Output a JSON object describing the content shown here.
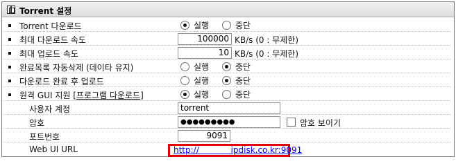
{
  "header": {
    "title": "Torrent 설정",
    "icon": "settings-grid-icon"
  },
  "rows": [
    {
      "label": "Torrent 다운로드",
      "options": [
        "실행",
        "중단"
      ],
      "selected": 0
    },
    {
      "label": "최대 다운로드 속도",
      "value": "100000",
      "unit": "KB/s (0 : 무제한)"
    },
    {
      "label": "최대 업로드 속도",
      "value": "10",
      "unit": "KB/s (0 : 무제한)"
    },
    {
      "label": "완료목록 자동삭제 (데이타 유지)",
      "options": [
        "실행",
        "중단"
      ],
      "selected": 1
    },
    {
      "label": "다운로드 완료 후 업로드",
      "options": [
        "실행",
        "중단"
      ],
      "selected": 1
    },
    {
      "label_prefix": "원격 GUI 지원 [",
      "label_link": "프로그램 다운로드",
      "label_suffix": "]",
      "options": [
        "실행",
        "중단"
      ],
      "selected": 0
    }
  ],
  "account": {
    "label": "사용자 계정",
    "value": "torrent"
  },
  "password": {
    "label": "암호",
    "value": "●●●●●●●●●",
    "show_label": "암호 보이기"
  },
  "port": {
    "label": "포트번호",
    "value": "9091"
  },
  "webui": {
    "label": "Web UI URL",
    "url": "http://            ipdisk.co.kr:9091"
  },
  "colors": {
    "highlight": "#e00000",
    "link": "#0000ee"
  }
}
